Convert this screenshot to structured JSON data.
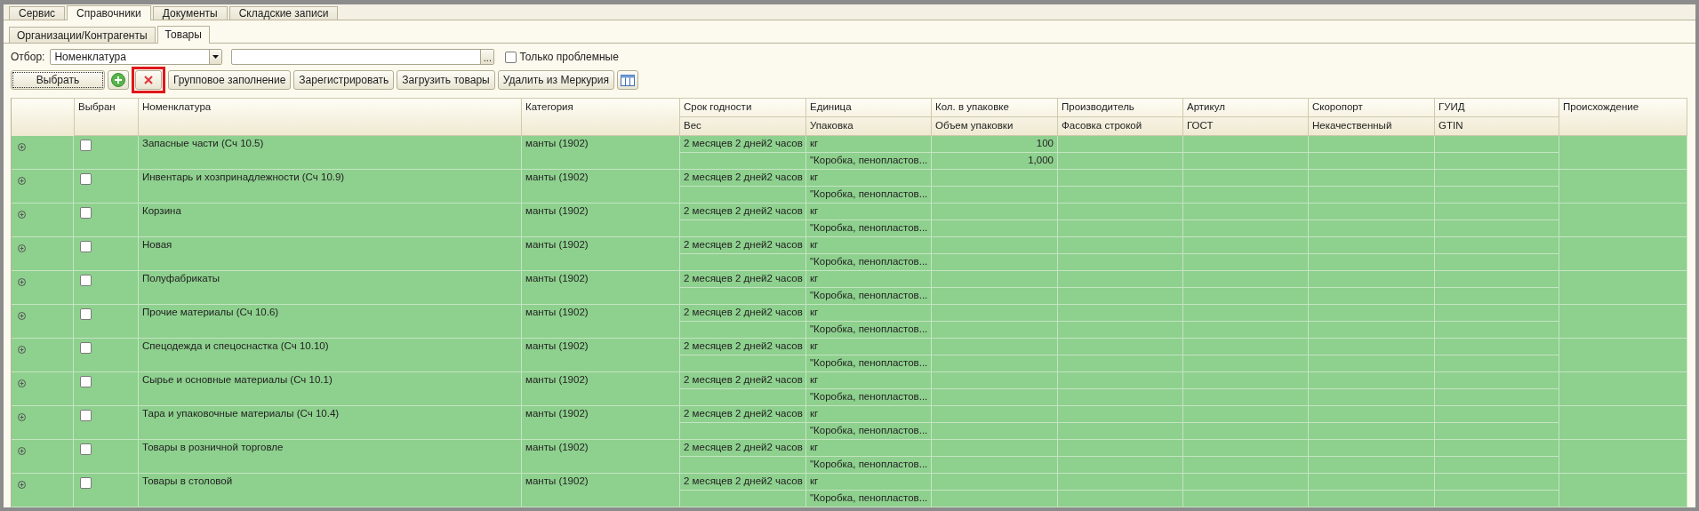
{
  "top_tabs": [
    {
      "label": "Сервис",
      "selected": false
    },
    {
      "label": "Справочники",
      "selected": true
    },
    {
      "label": "Документы",
      "selected": false
    },
    {
      "label": "Складские записи",
      "selected": false
    }
  ],
  "sub_tabs": [
    {
      "label": "Организации/Контрагенты",
      "selected": false
    },
    {
      "label": "Товары",
      "selected": true
    }
  ],
  "filter": {
    "label": "Отбор:",
    "value": "Номенклатура",
    "select_button": "...",
    "only_problem": {
      "label": "Только проблемные",
      "checked": false
    }
  },
  "toolbar": [
    {
      "kind": "text",
      "label": "Выбрать",
      "focused": true,
      "highlighted": false
    },
    {
      "kind": "add",
      "focused": false,
      "highlighted": false
    },
    {
      "kind": "delete",
      "focused": false,
      "highlighted": true
    },
    {
      "kind": "text",
      "label": "Групповое заполнение",
      "focused": false,
      "highlighted": false
    },
    {
      "kind": "text",
      "label": "Зарегистрировать",
      "focused": false,
      "highlighted": false
    },
    {
      "kind": "text",
      "label": "Загрузить товары",
      "focused": false,
      "highlighted": false
    },
    {
      "kind": "text",
      "label": "Удалить из Меркурия",
      "focused": false,
      "highlighted": false
    },
    {
      "kind": "columns",
      "focused": false,
      "highlighted": false
    }
  ],
  "table": {
    "columns": [
      {
        "label": "Выбран"
      },
      {
        "label": "Номенклатура"
      },
      {
        "label": "Категория"
      },
      {
        "label": "Срок годности",
        "sublabel": "Вес"
      },
      {
        "label": "Единица",
        "sublabel": "Упаковка"
      },
      {
        "label": "Кол. в упаковке",
        "sublabel": "Объем упаковки"
      },
      {
        "label": "Производитель",
        "sublabel": "Фасовка строкой"
      },
      {
        "label": "Артикул",
        "sublabel": "ГОСТ"
      },
      {
        "label": "Скоропорт",
        "sublabel": "Некачественный"
      },
      {
        "label": "ГУИД",
        "sublabel": "GTIN"
      },
      {
        "label": "Происхождение"
      }
    ],
    "rows": [
      {
        "expanded": false,
        "checked": false,
        "name": "Запасные части (Сч 10.5)",
        "category": "манты (1902)",
        "shelf_life": "2 месяцев 2 дней2 часов",
        "unit": "кг",
        "package": "\"Коробка, пенопластов...",
        "quantity": "100",
        "volume": "1,000"
      },
      {
        "expanded": false,
        "checked": false,
        "name": "Инвентарь и хозпринадлежности (Сч 10.9)",
        "category": "манты (1902)",
        "shelf_life": "2 месяцев 2 дней2 часов",
        "unit": "кг",
        "package": "\"Коробка, пенопластов..."
      },
      {
        "expanded": false,
        "checked": false,
        "name": "Корзина",
        "category": "манты (1902)",
        "shelf_life": "2 месяцев 2 дней2 часов",
        "unit": "кг",
        "package": "\"Коробка, пенопластов..."
      },
      {
        "expanded": false,
        "checked": false,
        "name": "Новая",
        "category": "манты (1902)",
        "shelf_life": "2 месяцев 2 дней2 часов",
        "unit": "кг",
        "package": "\"Коробка, пенопластов..."
      },
      {
        "expanded": false,
        "checked": false,
        "name": "Полуфабрикаты",
        "category": "манты (1902)",
        "shelf_life": "2 месяцев 2 дней2 часов",
        "unit": "кг",
        "package": "\"Коробка, пенопластов..."
      },
      {
        "expanded": false,
        "checked": false,
        "name": "Прочие материалы (Сч 10.6)",
        "category": "манты (1902)",
        "shelf_life": "2 месяцев 2 дней2 часов",
        "unit": "кг",
        "package": "\"Коробка, пенопластов..."
      },
      {
        "expanded": false,
        "checked": false,
        "name": "Спецодежда и спецоснастка (Сч 10.10)",
        "category": "манты (1902)",
        "shelf_life": "2 месяцев 2 дней2 часов",
        "unit": "кг",
        "package": "\"Коробка, пенопластов..."
      },
      {
        "expanded": false,
        "checked": false,
        "name": "Сырье и основные материалы (Сч 10.1)",
        "category": "манты (1902)",
        "shelf_life": "2 месяцев 2 дней2 часов",
        "unit": "кг",
        "package": "\"Коробка, пенопластов..."
      },
      {
        "expanded": false,
        "checked": false,
        "name": "Тара и упаковочные материалы (Сч 10.4)",
        "category": "манты (1902)",
        "shelf_life": "2 месяцев 2 дней2 часов",
        "unit": "кг",
        "package": "\"Коробка, пенопластов..."
      },
      {
        "expanded": false,
        "checked": false,
        "name": "Товары в розничной торговле",
        "category": "манты (1902)",
        "shelf_life": "2 месяцев 2 дней2 часов",
        "unit": "кг",
        "package": "\"Коробка, пенопластов..."
      },
      {
        "expanded": false,
        "checked": false,
        "name": "Товары в столовой",
        "category": "манты (1902)",
        "shelf_life": "2 месяцев 2 дней2 часов",
        "unit": "кг",
        "package": "\"Коробка, пенопластов..."
      }
    ]
  }
}
